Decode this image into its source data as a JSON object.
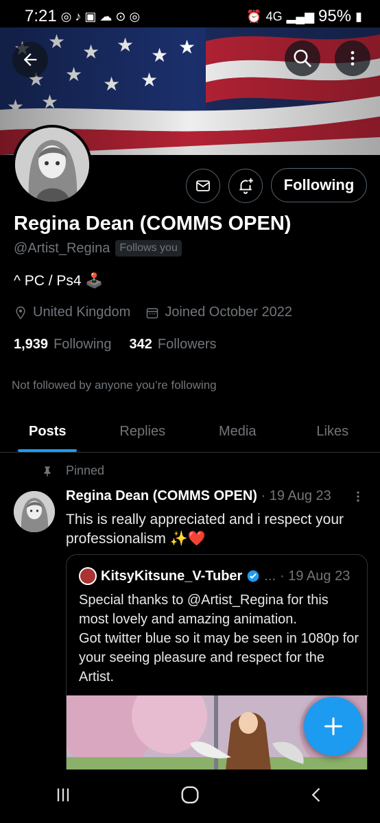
{
  "status_bar": {
    "time": "7:21",
    "battery": "95%",
    "network": "4G"
  },
  "header": {
    "back_icon": "arrow-left-icon",
    "search_icon": "search-icon",
    "more_icon": "more-vertical-icon"
  },
  "profile": {
    "name": "Regina Dean (COMMS OPEN)",
    "handle": "@Artist_Regina",
    "follows_badge": "Follows you",
    "bio": "^ PC / Ps4 🕹️",
    "location": "United Kingdom",
    "joined": "Joined October 2022",
    "following_count": "1,939",
    "following_label": "Following",
    "followers_count": "342",
    "followers_label": "Followers",
    "not_followed_text": "Not followed by anyone you’re following",
    "follow_button": "Following"
  },
  "tabs": [
    {
      "label": "Posts",
      "active": true
    },
    {
      "label": "Replies",
      "active": false
    },
    {
      "label": "Media",
      "active": false
    },
    {
      "label": "Likes",
      "active": false
    }
  ],
  "post": {
    "pinned_label": "Pinned",
    "author": "Regina Dean (COMMS OPEN)",
    "date": "· 19 Aug 23",
    "text": "This is really appreciated and i respect your professionalism ✨❤️",
    "quote": {
      "author": "KitsyKitsune_V-Tuber",
      "badge": "...",
      "date": "· 19 Aug 23",
      "text": "Special thanks to @Artist_Regina for this most lovely and amazing animation.\nGot twitter blue so it may be seen in 1080p for your seeing pleasure and respect for the Artist."
    }
  },
  "fab": {
    "label": "+"
  },
  "colors": {
    "accent": "#1d9bf0",
    "background": "#000000",
    "muted": "#71767b"
  }
}
